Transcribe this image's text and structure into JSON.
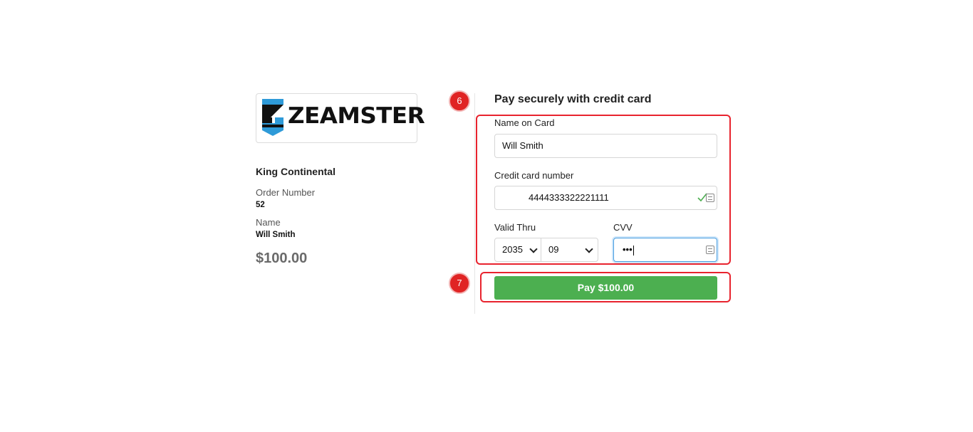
{
  "brand": {
    "logo_text": "ZEAMSTER",
    "colors": {
      "blue": "#2e9ad8",
      "dark": "#111111"
    }
  },
  "summary": {
    "merchant": "King Continental",
    "order_label": "Order Number",
    "order_value": "52",
    "name_label": "Name",
    "name_value": "Will Smith",
    "amount": "$100.00"
  },
  "form": {
    "title": "Pay securely with credit card",
    "name_label": "Name on Card",
    "name_value": "Will Smith",
    "card_label": "Credit card number",
    "card_value": "4444333322221111",
    "valid_label": "Valid Thru",
    "year_value": "2035",
    "month_value": "09",
    "cvv_label": "CVV",
    "cvv_value": "•••",
    "pay_label": "Pay $100.00"
  },
  "annotations": {
    "step_form": "6",
    "step_pay": "7",
    "highlight_color": "#e8232e"
  },
  "colors": {
    "pay_button": "#4caf50",
    "focus_border": "#4a9fe0",
    "valid_check": "#4caf50"
  }
}
